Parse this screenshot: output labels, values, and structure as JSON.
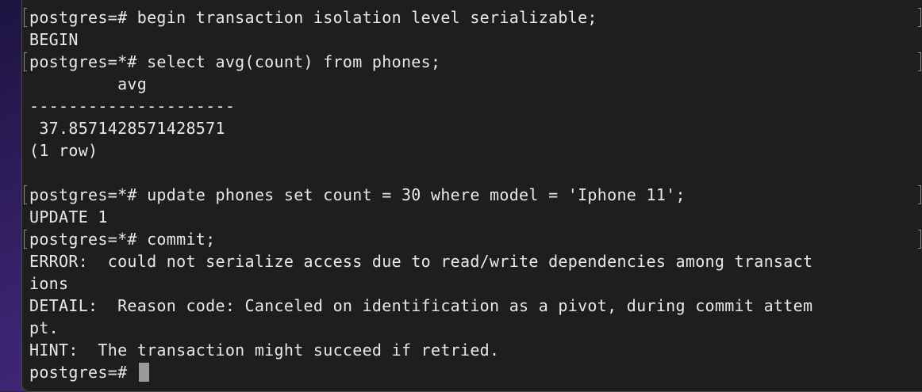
{
  "terminal": {
    "lines": [
      "postgres=# begin transaction isolation level serializable;",
      "BEGIN",
      "postgres=*# select avg(count) from phones;",
      "         avg",
      "---------------------",
      " 37.8571428571428571",
      "(1 row)",
      "",
      "postgres=*# update phones set count = 30 where model = 'Iphone 11';",
      "UPDATE 1",
      "postgres=*# commit;",
      "ERROR:  could not serialize access due to read/write dependencies among transact",
      "ions",
      "DETAIL:  Reason code: Canceled on identification as a pivot, during commit attem",
      "pt.",
      "HINT:  The transaction might succeed if retried."
    ],
    "prompt": "postgres=# "
  }
}
